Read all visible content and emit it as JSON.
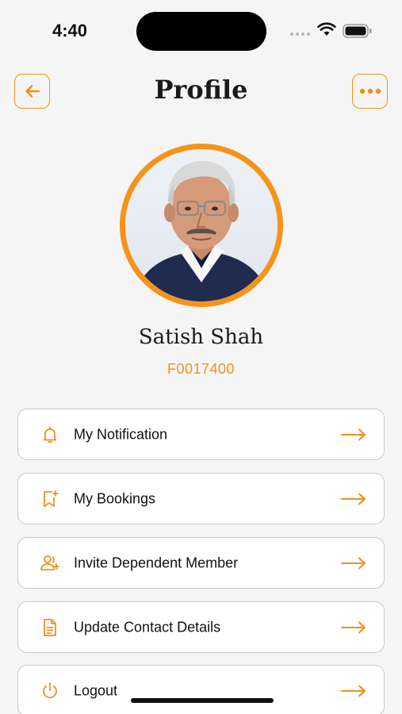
{
  "status_bar": {
    "time": "4:40"
  },
  "header": {
    "title": "Profile",
    "back_icon": "arrow-left-icon",
    "more_icon": "more-horizontal-icon"
  },
  "profile": {
    "name": "Satish Shah",
    "member_id": "F0017400"
  },
  "menu": {
    "items": [
      {
        "label": "My Notification",
        "icon": "bell-icon"
      },
      {
        "label": "My Bookings",
        "icon": "bookmark-plus-icon"
      },
      {
        "label": "Invite Dependent Member",
        "icon": "user-add-icon"
      },
      {
        "label": "Update Contact Details",
        "icon": "document-icon"
      },
      {
        "label": "Logout",
        "icon": "power-icon"
      }
    ]
  },
  "colors": {
    "accent": "#f0901b",
    "background": "#f5f5f5",
    "card": "#ffffff",
    "card_border": "#c9c9c9"
  }
}
